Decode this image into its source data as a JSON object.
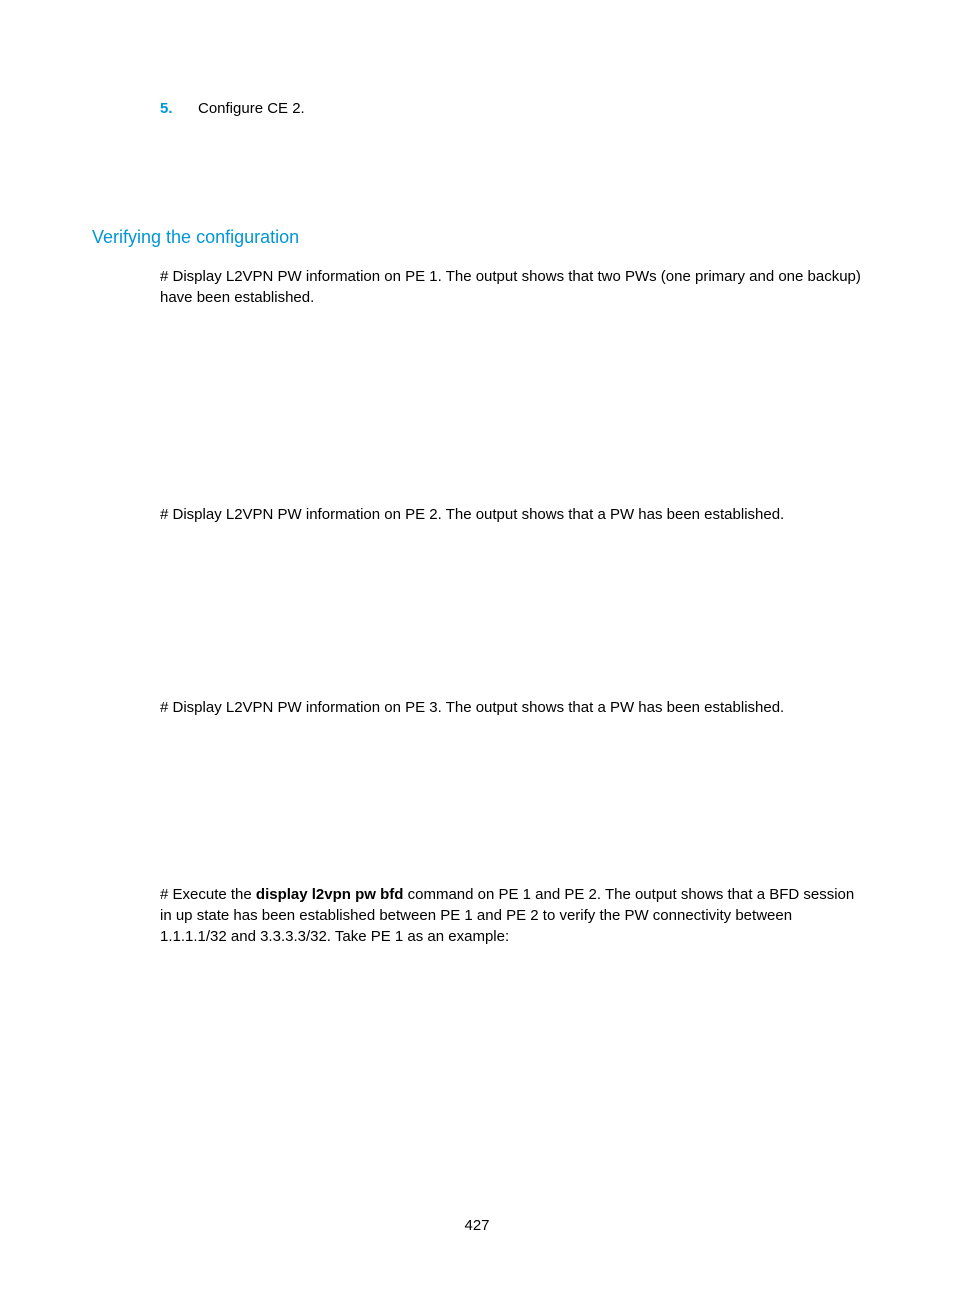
{
  "step": {
    "number": "5.",
    "text": "Configure CE 2."
  },
  "heading": "Verifying the configuration",
  "para1": "# Display L2VPN PW information on PE 1. The output shows that two PWs (one primary and one backup) have been established.",
  "para2": "# Display L2VPN PW information on PE 2. The output shows that a PW has been established.",
  "para3": "# Display L2VPN PW information on PE 3. The output shows that a PW has been established.",
  "para4_pre": "# Execute the ",
  "para4_bold": "display l2vpn pw bfd",
  "para4_post": " command on PE 1 and PE 2. The output shows that a BFD session in up state has been established between PE 1 and PE 2 to verify the PW connectivity between 1.1.1.1/32 and 3.3.3.3/32. Take PE 1 as an example:",
  "pageNumber": "427"
}
